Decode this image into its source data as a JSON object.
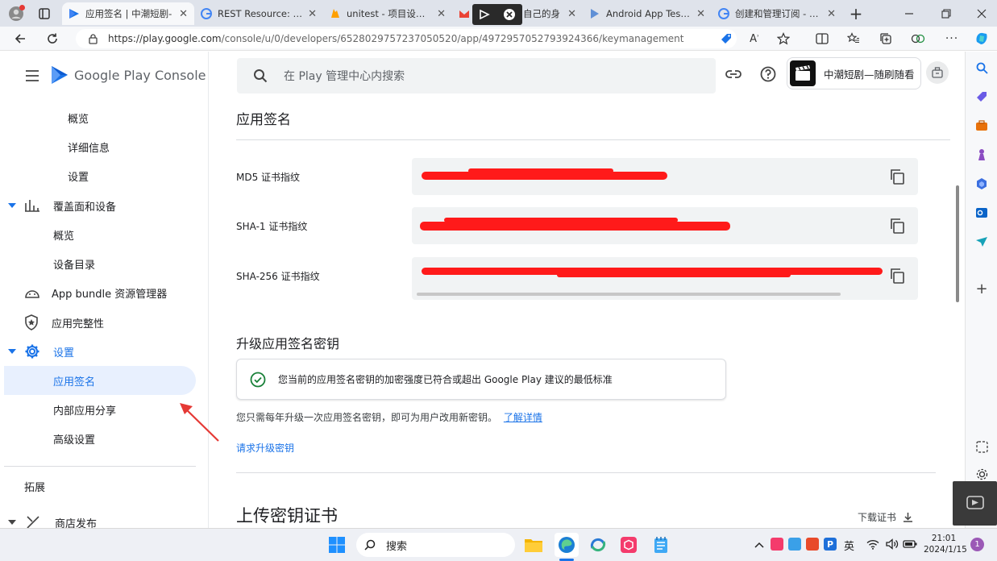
{
  "browser": {
    "tabs": [
      {
        "title": "应用签名 | 中潮短剧-",
        "active": true
      },
      {
        "title": "REST Resource: purch",
        "active": false
      },
      {
        "title": "unitest - 项目设置 - 知",
        "active": false
      },
      {
        "title": "自己的身",
        "active": false
      },
      {
        "title": "Android App Testing",
        "active": false
      },
      {
        "title": "创建和管理订阅 - Pla",
        "active": false
      }
    ],
    "url_host": "https://play.google.com",
    "url_path": "/console/u/0/developers/6528029757237050520/app/4972957052793924366/keymanagement"
  },
  "header": {
    "brand": "Google Play Console",
    "search_placeholder": "在 Play 管理中心内搜索",
    "app_name": "中潮短剧—随刷随看"
  },
  "sidebar": {
    "items": [
      {
        "label": "概览"
      },
      {
        "label": "详细信息"
      },
      {
        "label": "设置"
      },
      {
        "label": "覆盖面和设备"
      },
      {
        "label": "概览"
      },
      {
        "label": "设备目录"
      },
      {
        "label": "App bundle 资源管理器"
      },
      {
        "label": "应用完整性"
      },
      {
        "label": "设置"
      },
      {
        "label": "应用签名"
      },
      {
        "label": "内部应用分享"
      },
      {
        "label": "高级设置"
      },
      {
        "label": "拓展"
      },
      {
        "label": "商店发布"
      }
    ]
  },
  "main": {
    "section_title": "应用签名",
    "fingerprints": [
      {
        "label": "MD5 证书指纹"
      },
      {
        "label": "SHA-1 证书指纹"
      },
      {
        "label": "SHA-256 证书指纹"
      }
    ],
    "upgrade_title": "升级应用签名密钥",
    "info_text": "您当前的应用签名密钥的加密强度已符合或超出 Google Play 建议的最低标准",
    "upgrade_desc": "您只需每年升级一次应用签名密钥，即可为用户改用新密钥。",
    "learn_more": "了解详情",
    "request_upgrade": "请求升级密钥",
    "upload_title": "上传密钥证书",
    "download_cert": "下载证书"
  },
  "taskbar": {
    "search_label": "搜索",
    "ime": "英",
    "time": "21:01",
    "date": "2024/1/15",
    "badge": "1"
  },
  "colors": {
    "accent": "#1a73e8",
    "redaction": "#ff1a1a",
    "success": "#188038"
  }
}
